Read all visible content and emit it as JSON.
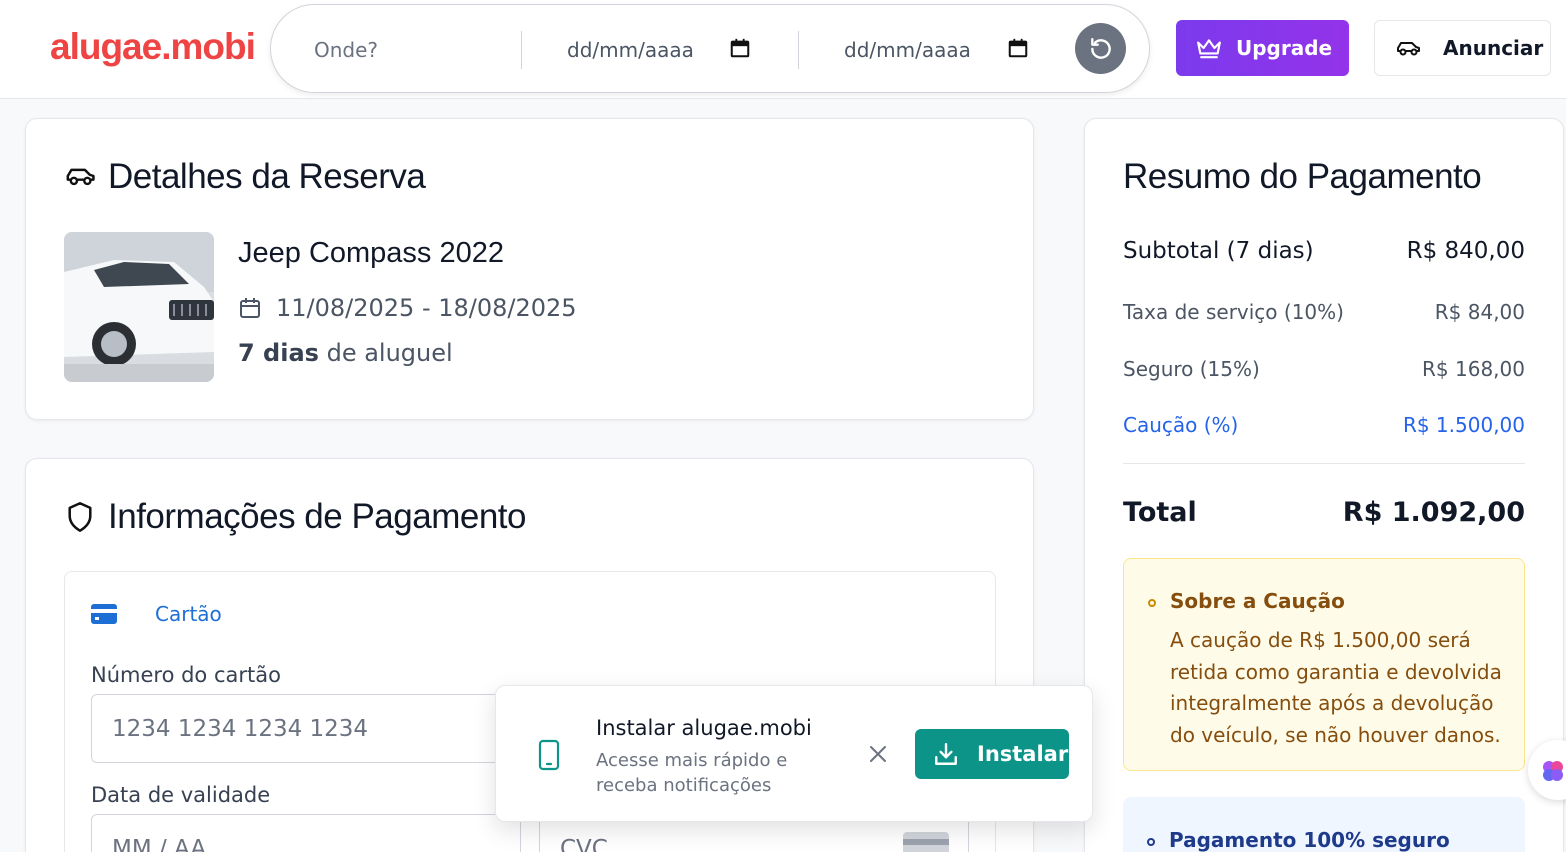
{
  "header": {
    "logo": "alugae.mobi",
    "search": {
      "where_placeholder": "Onde?",
      "start_date_placeholder": "dd/mm/aaaa",
      "end_date_placeholder": "dd/mm/aaaa"
    },
    "upgrade_label": "Upgrade",
    "advertise_label": "Anunciar"
  },
  "booking": {
    "title": "Detalhes da Reserva",
    "car_name": "Jeep Compass 2022",
    "dates": "11/08/2025 - 18/08/2025",
    "days_bold": "7 dias",
    "days_rest": " de aluguel"
  },
  "payment": {
    "title": "Informações de Pagamento",
    "method_label": "Cartão",
    "card_number_label": "Número do cartão",
    "card_number_placeholder": "1234 1234 1234 1234",
    "expiry_label": "Data de validade",
    "expiry_placeholder": "MM / AA",
    "cvc_placeholder": "CVC"
  },
  "summary": {
    "title": "Resumo do Pagamento",
    "rows": [
      {
        "label": "Subtotal (7 dias)",
        "value": "R$ 840,00"
      },
      {
        "label": "Taxa de serviço (10%)",
        "value": "R$ 84,00"
      },
      {
        "label": "Seguro (15%)",
        "value": "R$ 168,00"
      },
      {
        "label": "Caução (%)",
        "value": "R$ 1.500,00"
      }
    ],
    "total_label": "Total",
    "total_value": "R$ 1.092,00",
    "deposit_title": "Sobre a Caução",
    "deposit_text": "A caução de R$ 1.500,00 será retida como garantia e devolvida integralmente após a devolução do veículo, se não houver danos.",
    "secure_title": "Pagamento 100% seguro"
  },
  "install_prompt": {
    "title": "Instalar alugae.mobi",
    "subtitle": "Acesse mais rápido e receba notificações",
    "button_label": "Instalar"
  },
  "colors": {
    "brand": "#ef4444",
    "upgrade": "#7c3aed",
    "install": "#0d9488",
    "link_blue": "#2563eb"
  }
}
